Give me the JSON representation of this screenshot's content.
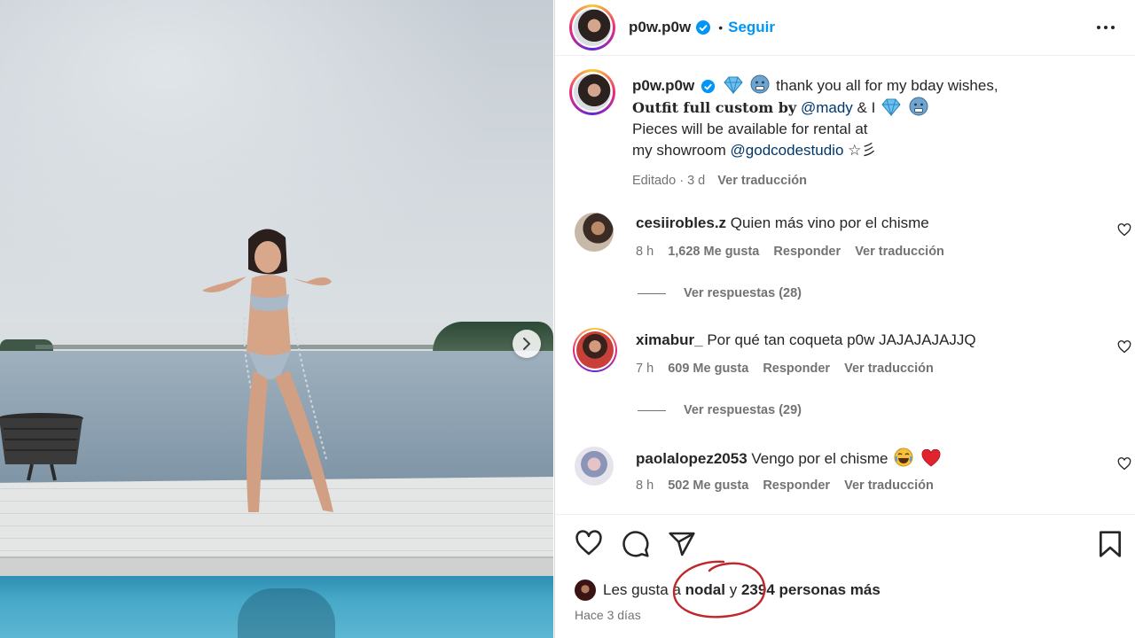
{
  "post": {
    "carousel_next_icon": "chevron-right-icon"
  },
  "header": {
    "username": "p0w.p0w",
    "separator": "•",
    "follow_label": "Seguir",
    "more_icon": "more-horizontal-icon"
  },
  "caption": {
    "username": "p0w.p0w",
    "text_line1": "thank you all for my bday wishes,",
    "text_bold": "Outfit full custom by",
    "mention1": "@mady",
    "text_amp": "& I",
    "text_line3": "Pieces will be available for rental at",
    "text_line4": "my showroom",
    "mention2": "@godcodestudio",
    "suffix": "☆彡",
    "edited": "Editado · 3 d",
    "translate": "Ver traducción"
  },
  "comments": [
    {
      "username": "cesiirobles.z",
      "text": "Quien más vino por el chisme",
      "time": "8 h",
      "likes": "1,628 Me gusta",
      "reply": "Responder",
      "translate": "Ver traducción",
      "view_replies": "Ver respuestas (28)"
    },
    {
      "username": "ximabur_",
      "text": "Por qué tan coqueta p0w JAJAJAJAJJQ",
      "time": "7 h",
      "likes": "609 Me gusta",
      "reply": "Responder",
      "translate": "Ver traducción",
      "view_replies": "Ver respuestas (29)"
    },
    {
      "username": "paolalopez2053",
      "text": "Vengo por el chisme",
      "time": "8 h",
      "likes": "502 Me gusta",
      "reply": "Responder",
      "translate": "Ver traducción"
    }
  ],
  "likes": {
    "prefix": "Les gusta a",
    "user": "nodal",
    "conj": "y",
    "count_text": "2394 personas más"
  },
  "time_ago": "Hace 3 días",
  "colors": {
    "accent": "#0095f6",
    "mention": "#00376b",
    "secondary_text": "#737373",
    "annotation": "#c0262b"
  }
}
